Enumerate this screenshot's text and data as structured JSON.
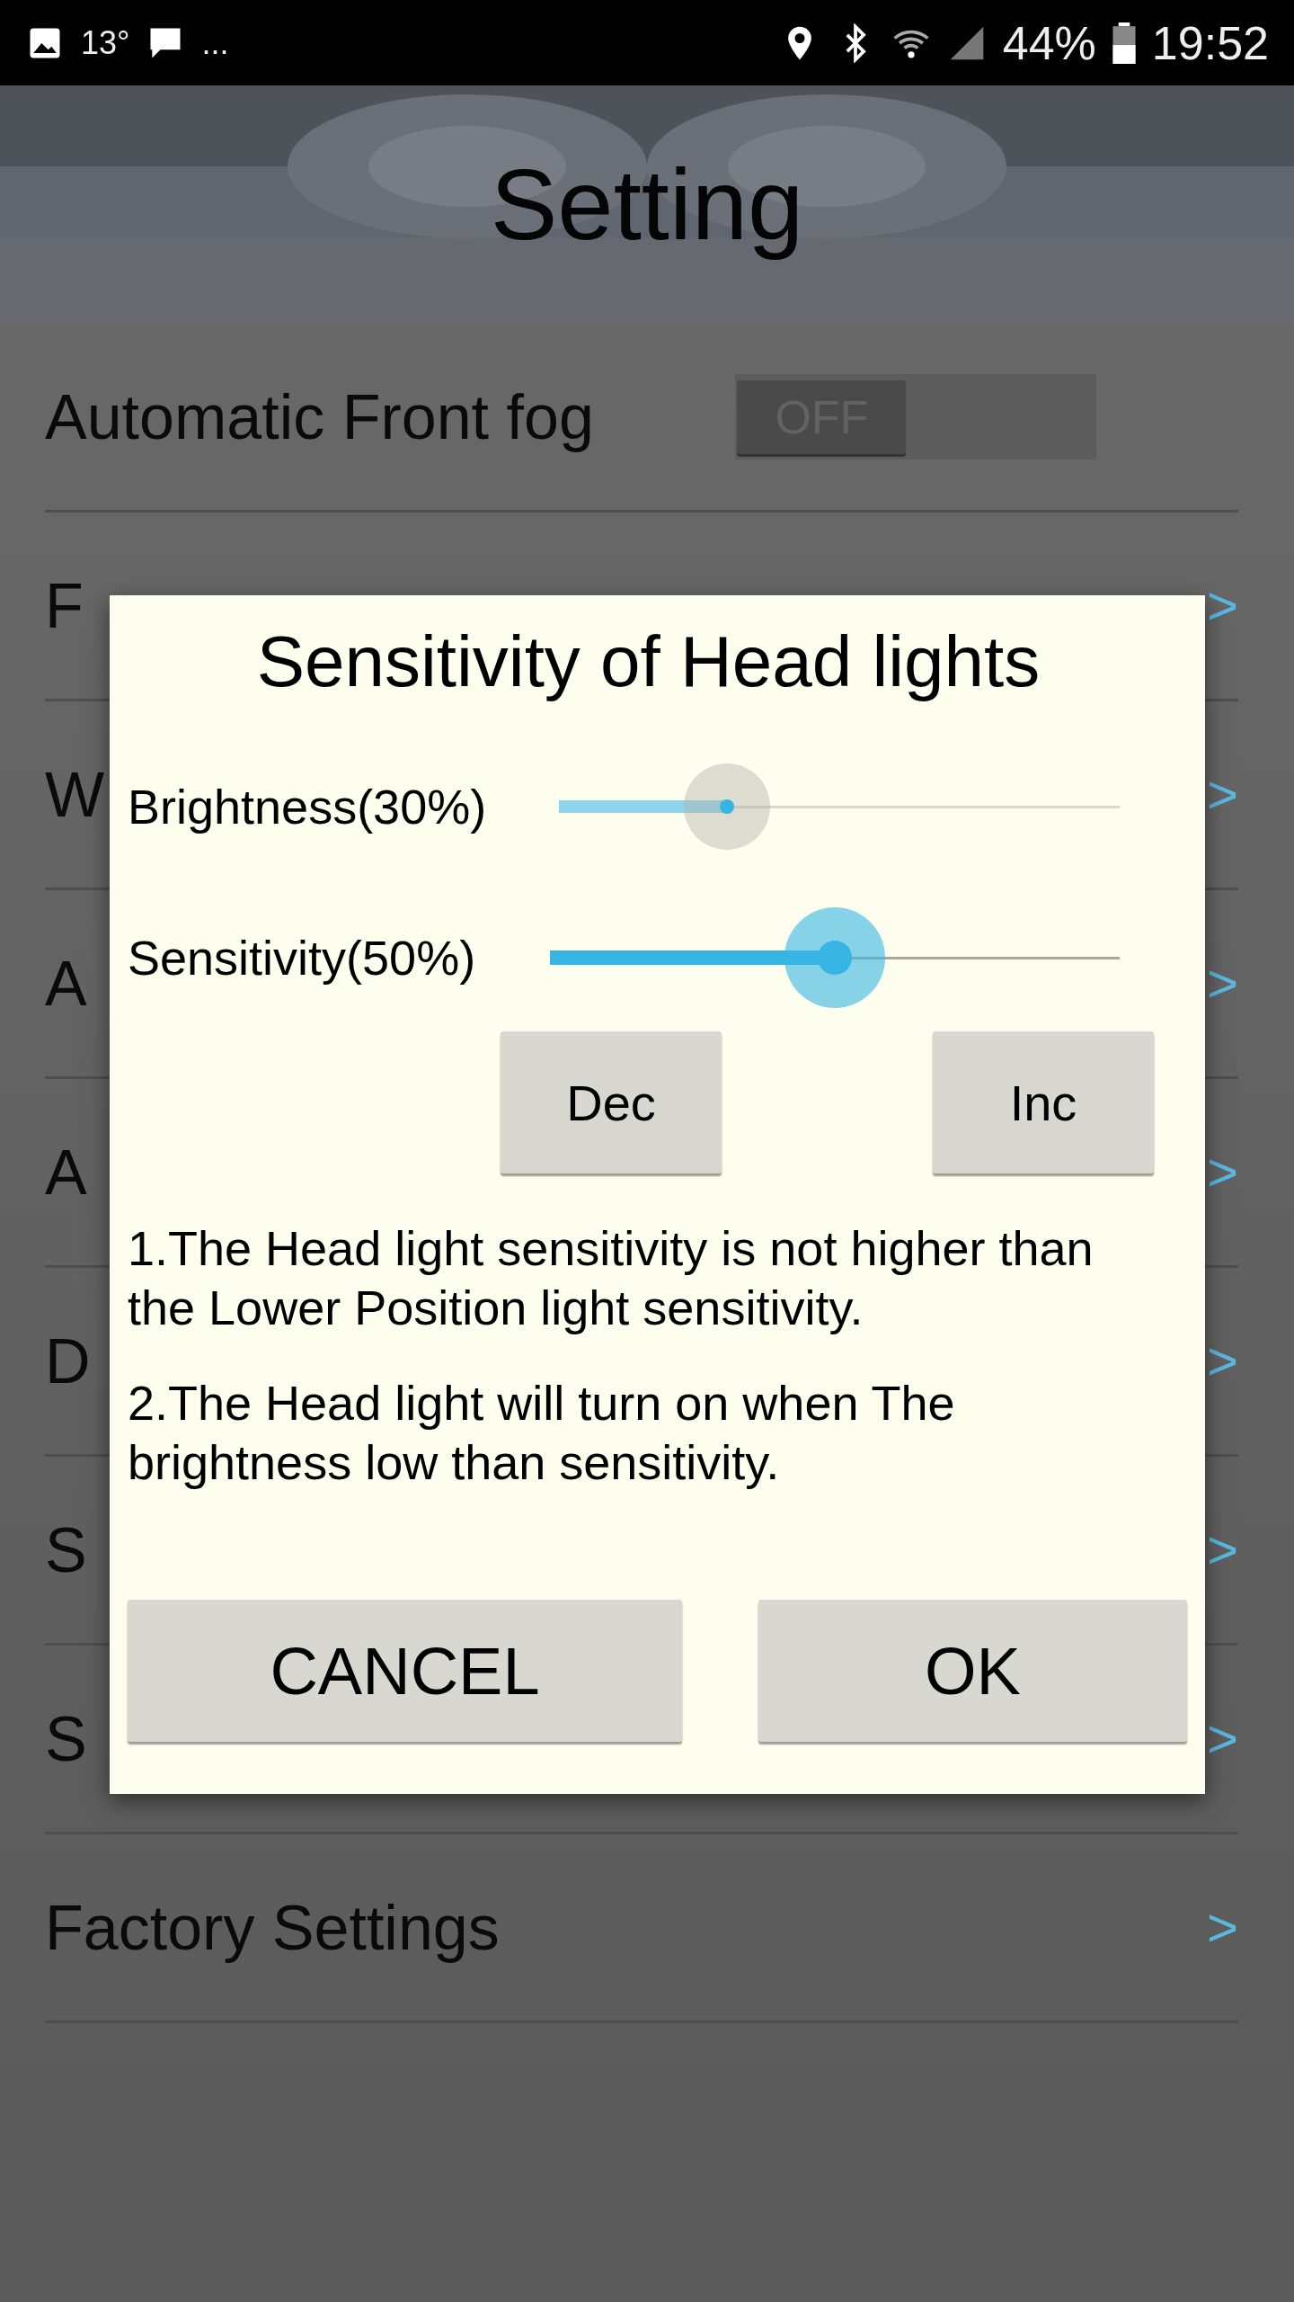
{
  "status_bar": {
    "temperature": "13°",
    "more": "...",
    "battery": "44%",
    "time": "19:52"
  },
  "header": {
    "title": "Setting"
  },
  "rows": [
    {
      "kind": "toggle",
      "label": "Automatic Front fog",
      "toggle": {
        "text": "OFF",
        "on": false
      }
    },
    {
      "kind": "link",
      "label": "F",
      "arrow": ">"
    },
    {
      "kind": "link",
      "label": "W",
      "arrow": ">"
    },
    {
      "kind": "link",
      "label": "A",
      "arrow": ">"
    },
    {
      "kind": "link",
      "label": "A",
      "arrow": ">"
    },
    {
      "kind": "link",
      "label": "D",
      "arrow": ">"
    },
    {
      "kind": "link",
      "label": "S",
      "arrow": ">"
    },
    {
      "kind": "link",
      "label": "S",
      "arrow": ">"
    },
    {
      "kind": "link",
      "label": "Factory Settings",
      "arrow": ">"
    }
  ],
  "dialog": {
    "title": "Sensitivity of Head lights",
    "sliders": [
      {
        "label": "Brightness(30%)",
        "level": 0.3,
        "focused": false
      },
      {
        "label": "Sensitivity(50%)",
        "level": 0.5,
        "focused": true
      }
    ],
    "step_buttons": [
      "Dec",
      "Inc"
    ],
    "notes": [
      "1.The Head light sensitivity is not higher than the Lower Position light sensitivity.",
      "2.The Head light will turn on when The brightness low than sensitivity."
    ],
    "buttons": [
      "CANCEL",
      "OK"
    ]
  }
}
